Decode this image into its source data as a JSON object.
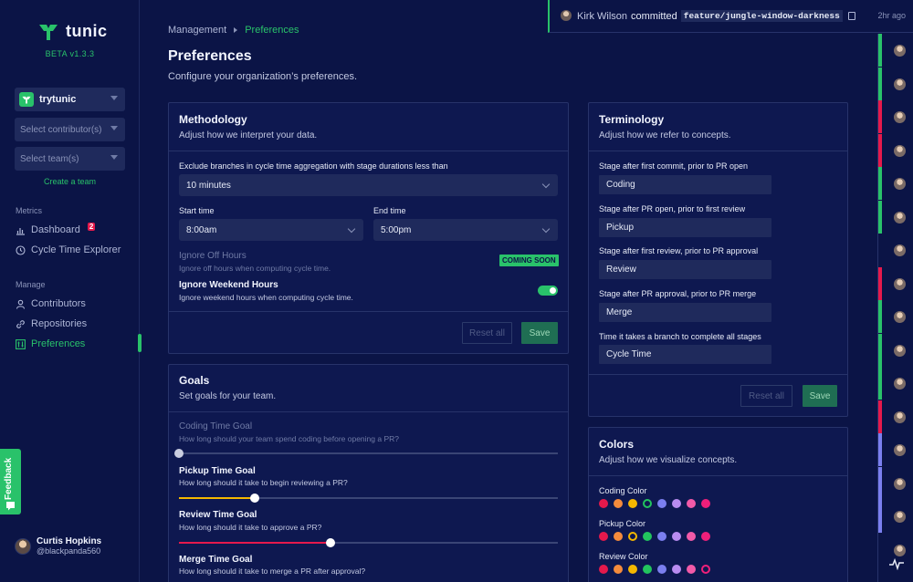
{
  "app": {
    "name": "tunic",
    "version": "BETA v1.3.3"
  },
  "sidebar": {
    "org_select": "trytunic",
    "contributors_placeholder": "Select contributor(s)",
    "teams_placeholder": "Select team(s)",
    "create_team": "Create a team",
    "metrics_heading": "Metrics",
    "metrics_items": [
      {
        "label": "Dashboard",
        "badge": "2",
        "icon": "bar-chart-icon"
      },
      {
        "label": "Cycle Time Explorer",
        "icon": "clock-icon"
      }
    ],
    "manage_heading": "Manage",
    "manage_items": [
      {
        "label": "Contributors",
        "icon": "person-icon"
      },
      {
        "label": "Repositories",
        "icon": "link-icon"
      },
      {
        "label": "Preferences",
        "icon": "sliders-icon",
        "active": true
      }
    ],
    "feedback": "Feedback",
    "user": {
      "name": "Curtis Hopkins",
      "handle": "@blackpanda560"
    }
  },
  "breadcrumb": {
    "parent": "Management",
    "current": "Preferences"
  },
  "page": {
    "title": "Preferences",
    "subtitle": "Configure your organization’s preferences."
  },
  "methodology": {
    "title": "Methodology",
    "subtitle": "Adjust how we interpret your data.",
    "exclude_label": "Exclude branches in cycle time aggregation with stage durations less than",
    "exclude_value": "10 minutes",
    "start_label": "Start time",
    "start_value": "8:00am",
    "end_label": "End time",
    "end_value": "5:00pm",
    "off_hours_title": "Ignore Off Hours",
    "off_hours_sub": "Ignore off hours when computing cycle time.",
    "coming_soon": "COMING SOON",
    "weekend_title": "Ignore Weekend Hours",
    "weekend_sub": "Ignore weekend hours when computing cycle time.",
    "weekend_on": true,
    "reset": "Reset all",
    "save": "Save"
  },
  "goals": {
    "title": "Goals",
    "subtitle": "Set goals for your team.",
    "items": [
      {
        "title": "Coding Time Goal",
        "sub": "How long should your team spend coding before opening a PR?",
        "level": 0.0,
        "color": "#e7ebf7",
        "muted": true
      },
      {
        "title": "Pickup Time Goal",
        "sub": "How long should it take to begin reviewing a PR?",
        "level": 0.2,
        "color": "#f5b700"
      },
      {
        "title": "Review Time Goal",
        "sub": "How long should it take to approve a PR?",
        "level": 0.4,
        "color": "#e5194c"
      },
      {
        "title": "Merge Time Goal",
        "sub": "How long should it take to merge a PR after approval?"
      }
    ]
  },
  "terminology": {
    "title": "Terminology",
    "subtitle": "Adjust how we refer to concepts.",
    "fields": [
      {
        "label": "Stage after first commit, prior to PR open",
        "value": "Coding"
      },
      {
        "label": "Stage after PR open, prior to first review",
        "value": "Pickup"
      },
      {
        "label": "Stage after first review, prior to PR approval",
        "value": "Review"
      },
      {
        "label": "Stage after PR approval, prior to PR merge",
        "value": "Merge"
      },
      {
        "label": "Time it takes a branch to complete all stages",
        "value": "Cycle Time"
      }
    ],
    "reset": "Reset all",
    "save": "Save"
  },
  "colors": {
    "title": "Colors",
    "subtitle": "Adjust how we visualize concepts.",
    "palette": [
      "#e5194c",
      "#f58b3c",
      "#f5b700",
      "#22c55e",
      "#7b7ff0",
      "#b98cf0",
      "#f25aa8",
      "#f01f7a"
    ],
    "groups": [
      {
        "label": "Coding Color",
        "selected": 3
      },
      {
        "label": "Pickup Color",
        "selected": 2
      },
      {
        "label": "Review Color",
        "selected": 7
      }
    ]
  },
  "notification": {
    "user": "Kirk Wilson",
    "action": "committed",
    "branch": "feature/jungle-window-darkness",
    "time": "2hr ago"
  },
  "rail": {
    "bars": [
      "#29c26a",
      "#29c26a",
      "#e5194c",
      "#e5194c",
      "#29c26a",
      "#29c26a",
      "#0b1446",
      "#e5194c",
      "#29c26a",
      "#29c26a",
      "#29c26a",
      "#e5194c",
      "#7b7ff0",
      "#7b7ff0",
      "#7b7ff0",
      "#0b1446"
    ]
  }
}
